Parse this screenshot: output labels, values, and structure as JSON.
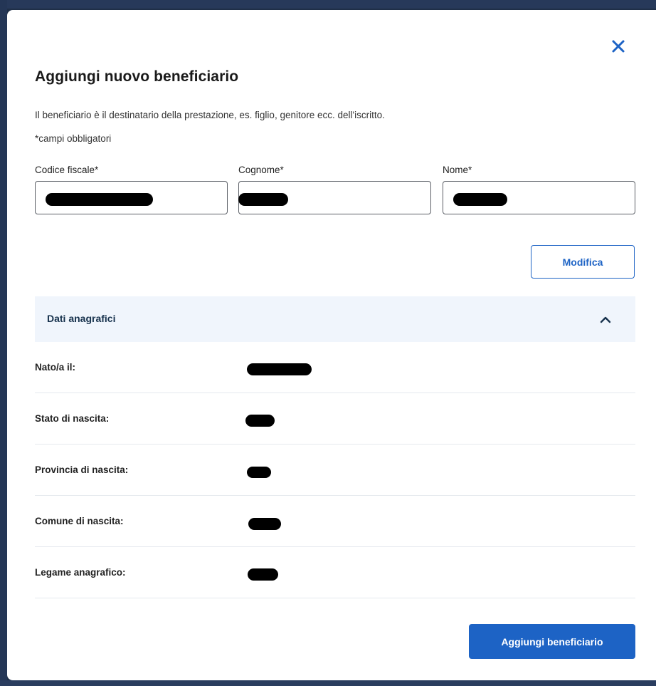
{
  "modal": {
    "title": "Aggiungi nuovo beneficiario",
    "description": "Il beneficiario è il destinatario della prestazione, es. figlio, genitore ecc. dell'iscritto.",
    "required_note": "*campi obbligatori",
    "close_icon": "close-icon"
  },
  "form": {
    "codice_fiscale_label": "Codice fiscale*",
    "cognome_label": "Cognome*",
    "nome_label": "Nome*"
  },
  "buttons": {
    "modifica_label": "Modifica",
    "submit_label": "Aggiungi beneficiario"
  },
  "accordion": {
    "title": "Dati anagrafici",
    "expanded": true,
    "rows": [
      {
        "label": "Nato/a il:"
      },
      {
        "label": "Stato di nascita:"
      },
      {
        "label": "Provincia di nascita:"
      },
      {
        "label": "Comune di nascita:"
      },
      {
        "label": "Legame anagrafico:"
      }
    ]
  },
  "colors": {
    "primary": "#1d63c5",
    "accordion_bg": "#f0f5fc",
    "accordion_title": "#17324d"
  }
}
